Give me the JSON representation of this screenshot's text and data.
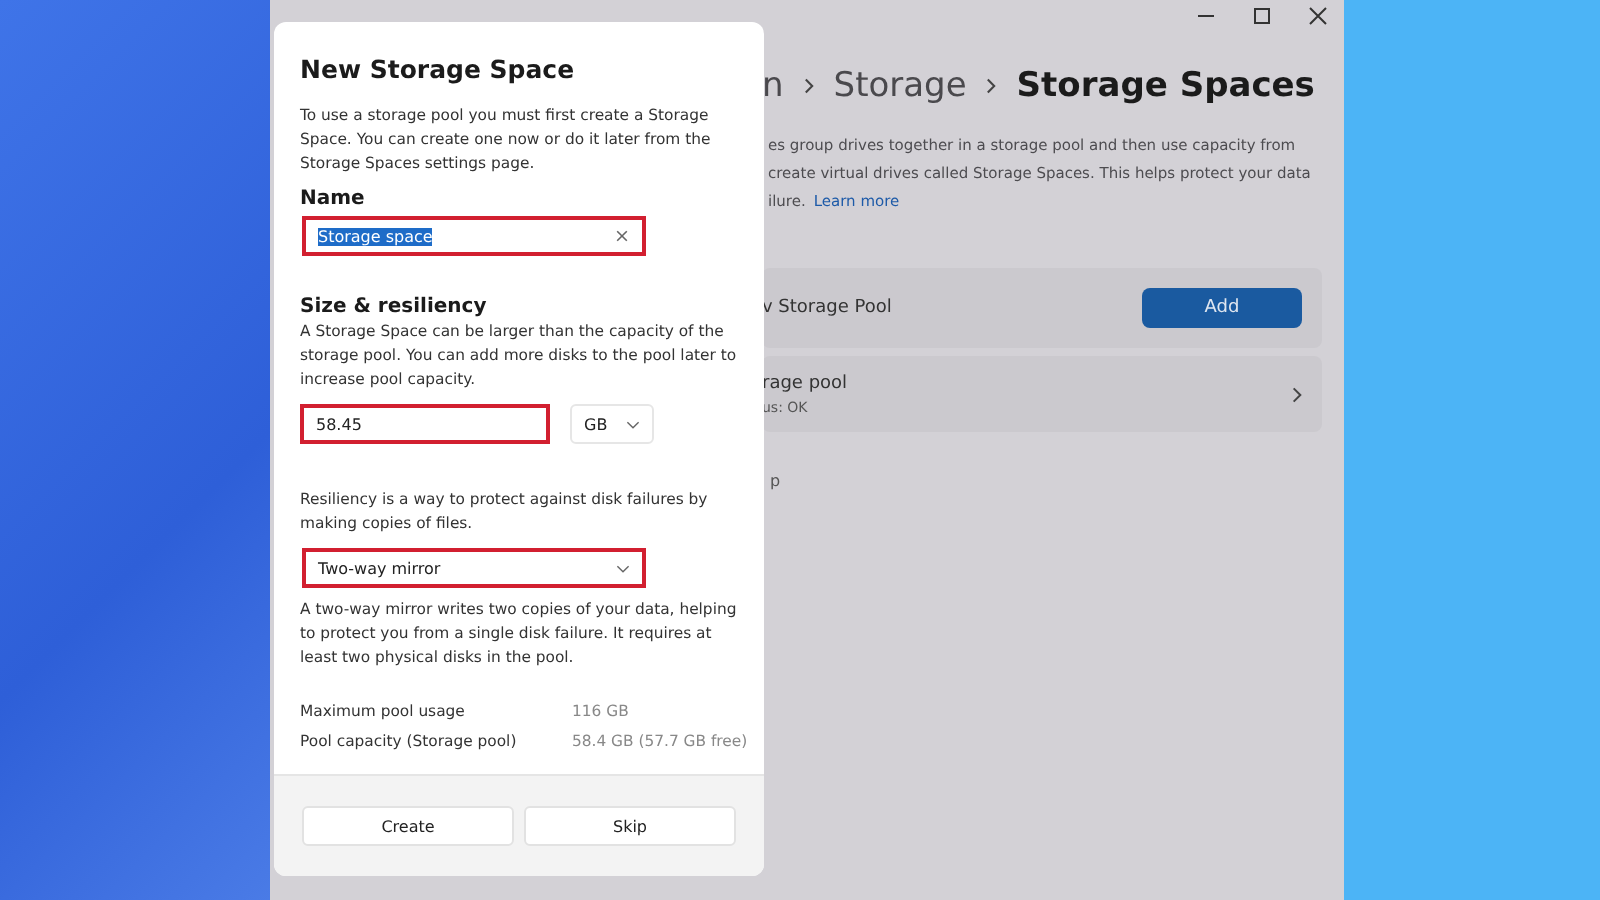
{
  "settings_window": {
    "breadcrumb": [
      "n",
      "Storage",
      "Storage Spaces"
    ],
    "description": [
      "es group drives together in a storage pool and then use capacity from",
      "create virtual drives called Storage Spaces. This helps protect your data"
    ],
    "description_end": "ilure.",
    "learn_more": "Learn more",
    "new_pool_row": {
      "label": "v Storage Pool",
      "button": "Add"
    },
    "pool_row": {
      "title": "rage pool",
      "status": "us: OK"
    },
    "fragment": "p"
  },
  "dialog": {
    "title": "New Storage Space",
    "intro": "To use a storage pool you must first create a Storage Space. You can create one now or do it later from the Storage Spaces settings page.",
    "name_label": "Name",
    "name_field": {
      "value": "Storage space",
      "text_selected": true,
      "highlighted": true
    },
    "size_label": "Size & resiliency",
    "size_text": "A Storage Space can be larger than the capacity of the storage pool. You can add more disks to the pool later to increase pool capacity.",
    "size_field": {
      "value": "58.45",
      "highlighted": true
    },
    "unit": "GB",
    "resiliency_text": "Resiliency is a way to protect against disk failures by making copies of files.",
    "resiliency": {
      "value": "Two-way mirror",
      "highlighted": true
    },
    "resiliency_note": "A two-way mirror writes two copies of your data, helping to protect you from a single disk failure. It requires at least two physical disks in the pool.",
    "stats": [
      {
        "label": "Maximum pool usage",
        "value": "116 GB"
      },
      {
        "label": "Pool capacity (Storage pool)",
        "value": "58.4 GB (57.7 GB free)"
      }
    ],
    "buttons": [
      "Create",
      "Skip"
    ]
  }
}
